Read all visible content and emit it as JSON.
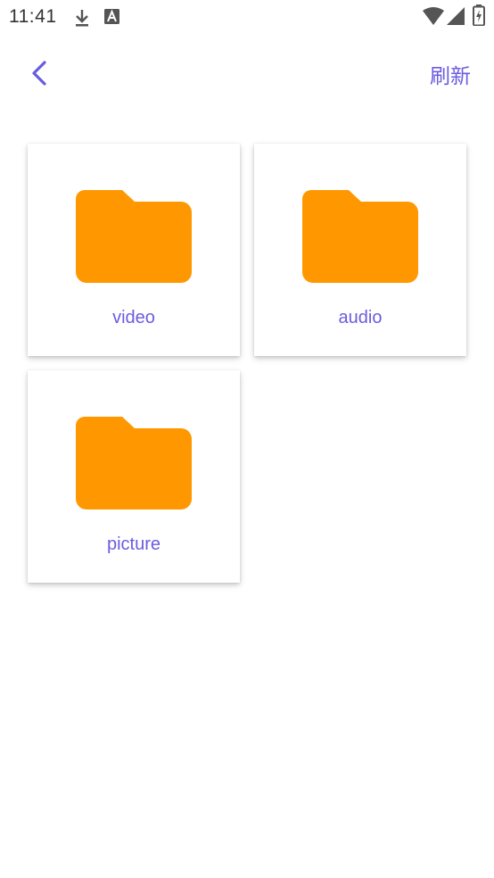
{
  "status_bar": {
    "time": "11:41",
    "icons": [
      "download-icon",
      "a-icon",
      "wifi-icon",
      "signal-icon",
      "battery-icon"
    ]
  },
  "app_bar": {
    "back_icon": "chevron-left-icon",
    "refresh_label": "刷新"
  },
  "folders": [
    {
      "label": "video",
      "icon": "folder-icon"
    },
    {
      "label": "audio",
      "icon": "folder-icon"
    },
    {
      "label": "picture",
      "icon": "folder-icon"
    }
  ],
  "colors": {
    "accent": "#6a5ce0",
    "folder": "#ff9800",
    "background": "#ffffff"
  }
}
